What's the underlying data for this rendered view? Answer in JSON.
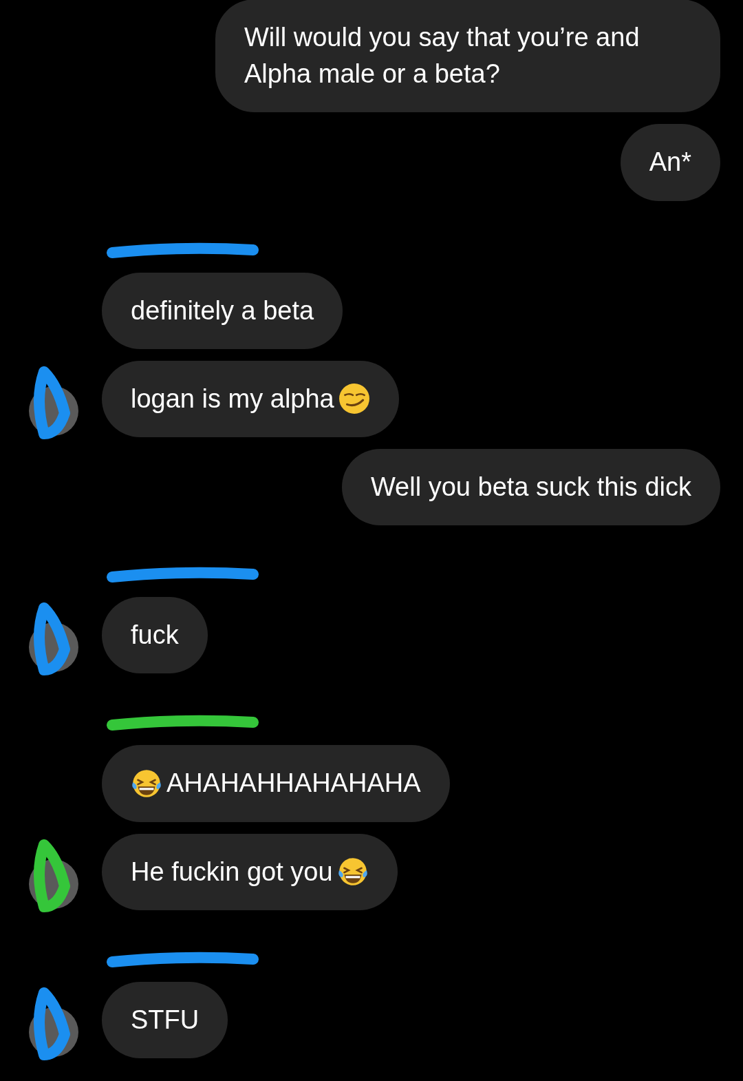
{
  "groups": [
    {
      "kind": "outgoing",
      "messages": [
        {
          "kind": "plain",
          "text": "Will would you say that you’re and Alpha male or a beta?"
        },
        {
          "kind": "plain",
          "text": "An*"
        }
      ]
    },
    {
      "kind": "incoming",
      "color": "#1b8ff0",
      "messages": [
        {
          "kind": "plain",
          "text": "definitely a beta"
        },
        {
          "kind": "smirk_after",
          "text": "logan is my alpha"
        }
      ]
    },
    {
      "kind": "outgoing",
      "messages": [
        {
          "kind": "plain",
          "text": "Well you beta suck this dick"
        }
      ]
    },
    {
      "kind": "incoming",
      "color": "#1b8ff0",
      "messages": [
        {
          "kind": "plain",
          "text": "fuck"
        }
      ]
    },
    {
      "kind": "incoming",
      "color": "#35c63a",
      "messages": [
        {
          "kind": "laugh_before",
          "text": "AHAHAHHAHAHAHA"
        },
        {
          "kind": "laugh_after",
          "text": "He fuckin got you"
        }
      ]
    },
    {
      "kind": "incoming",
      "color": "#1b8ff0",
      "messages": [
        {
          "kind": "plain",
          "text": "STFU"
        }
      ]
    }
  ]
}
